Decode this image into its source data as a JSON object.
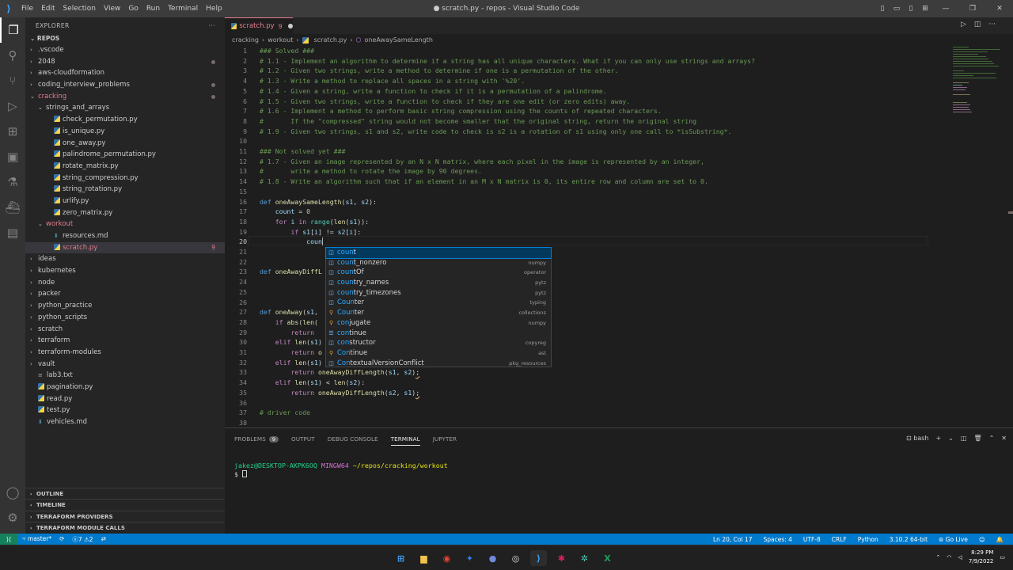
{
  "window": {
    "title": "● scratch.py - repos - Visual Studio Code"
  },
  "menu": [
    "File",
    "Edit",
    "Selection",
    "View",
    "Go",
    "Run",
    "Terminal",
    "Help"
  ],
  "explorer": {
    "header": "EXPLORER",
    "root": "REPOS",
    "rows": [
      {
        "indent": 1,
        "kind": "folder",
        "label": ".vscode",
        "mod": false,
        "open": false
      },
      {
        "indent": 1,
        "kind": "folder",
        "label": "2048",
        "mod": false,
        "open": false,
        "dot": true
      },
      {
        "indent": 1,
        "kind": "folder",
        "label": "aws-cloudformation",
        "mod": false,
        "open": false
      },
      {
        "indent": 1,
        "kind": "folder",
        "label": "coding_interview_problems",
        "mod": false,
        "open": false,
        "dot": true
      },
      {
        "indent": 1,
        "kind": "folder",
        "label": "cracking",
        "mod": true,
        "open": true,
        "dot": true
      },
      {
        "indent": 2,
        "kind": "folder",
        "label": "strings_and_arrays",
        "mod": false,
        "open": true
      },
      {
        "indent": 3,
        "kind": "py",
        "label": "check_permutation.py"
      },
      {
        "indent": 3,
        "kind": "py",
        "label": "is_unique.py"
      },
      {
        "indent": 3,
        "kind": "py",
        "label": "one_away.py"
      },
      {
        "indent": 3,
        "kind": "py",
        "label": "palindrome_permutation.py"
      },
      {
        "indent": 3,
        "kind": "py",
        "label": "rotate_matrix.py"
      },
      {
        "indent": 3,
        "kind": "py",
        "label": "string_compression.py"
      },
      {
        "indent": 3,
        "kind": "py",
        "label": "string_rotation.py"
      },
      {
        "indent": 3,
        "kind": "py",
        "label": "urlify.py"
      },
      {
        "indent": 3,
        "kind": "py",
        "label": "zero_matrix.py"
      },
      {
        "indent": 2,
        "kind": "folder",
        "label": "workout",
        "mod": true,
        "open": true
      },
      {
        "indent": 3,
        "kind": "md",
        "label": "resources.md"
      },
      {
        "indent": 3,
        "kind": "py",
        "label": "scratch.py",
        "mod": true,
        "sel": true,
        "count": "9"
      },
      {
        "indent": 1,
        "kind": "folder",
        "label": "ideas"
      },
      {
        "indent": 1,
        "kind": "folder",
        "label": "kubernetes"
      },
      {
        "indent": 1,
        "kind": "folder",
        "label": "node"
      },
      {
        "indent": 1,
        "kind": "folder",
        "label": "packer"
      },
      {
        "indent": 1,
        "kind": "folder",
        "label": "python_practice"
      },
      {
        "indent": 1,
        "kind": "folder",
        "label": "python_scripts"
      },
      {
        "indent": 1,
        "kind": "folder",
        "label": "scratch"
      },
      {
        "indent": 1,
        "kind": "folder",
        "label": "terraform"
      },
      {
        "indent": 1,
        "kind": "folder",
        "label": "terraform-modules"
      },
      {
        "indent": 1,
        "kind": "folder",
        "label": "vault"
      },
      {
        "indent": 1,
        "kind": "txt",
        "label": "lab3.txt"
      },
      {
        "indent": 1,
        "kind": "py",
        "label": "pagination.py"
      },
      {
        "indent": 1,
        "kind": "py",
        "label": "read.py"
      },
      {
        "indent": 1,
        "kind": "py",
        "label": "test.py"
      },
      {
        "indent": 1,
        "kind": "md",
        "label": "vehicles.md"
      }
    ],
    "panels": [
      "OUTLINE",
      "TIMELINE",
      "TERRAFORM PROVIDERS",
      "TERRAFORM MODULE CALLS"
    ]
  },
  "tab": {
    "name": "scratch.py",
    "problems": "9"
  },
  "breadcrumb": [
    "cracking",
    "workout",
    "scratch.py",
    "oneAwaySameLength"
  ],
  "code": {
    "line_numbers": [
      "1",
      "2",
      "3",
      "4",
      "5",
      "6",
      "7",
      "8",
      "9",
      "10",
      "11",
      "12",
      "13",
      "14",
      "15",
      "16",
      "17",
      "18",
      "19",
      "20",
      "21",
      "22",
      "23",
      "24",
      "25",
      "26",
      "27",
      "28",
      "29",
      "30",
      "31",
      "32",
      "33",
      "34",
      "35",
      "36",
      "37",
      "38"
    ],
    "lines": {
      "l1": "### Solved ###",
      "l2": "# 1.1 - Implement an algorithm to determine if a string has all unique characters. What if you can only use strings and arrays?",
      "l3": "# 1.2 - Given two strings, write a method to determine if one is a permutation of the other.",
      "l4": "# 1.3 - Write a method to replace all spaces in a string with '%20'.",
      "l5": "# 1.4 - Given a string, write a function to check if it is a permutation of a palindrome.",
      "l6": "# 1.5 - Given two strings, write a function to check if they are one edit (or zero edits) away.",
      "l7": "# 1.6 - Implement a method to perform basic string compression using the counts of repeated characters.",
      "l8": "#       If the \"compressed\" string would not become smaller that the original string, return the original string",
      "l9": "# 1.9 - Given two strings, s1 and s2, write code to check is s2 is a rotation of s1 using only one call to *isSubstring*.",
      "l11": "### Not solved yet ###",
      "l12": "# 1.7 - Given an image represented by an N x N matrix, where each pixel in the image is represented by an integer,",
      "l13": "#       write a method to rotate the image by 90 degrees.",
      "l14": "# 1.8 - Write an algorithm such that if an element in an M x N matrix is 0, its entire row and column are set to 0.",
      "l37": "# driver code"
    }
  },
  "suggest": [
    {
      "typed": "coun",
      "rest": "t",
      "src": "",
      "icon": "var"
    },
    {
      "typed": "coun",
      "rest": "t_nonzero",
      "src": "numpy",
      "icon": "var"
    },
    {
      "typed": "coun",
      "rest": "tOf",
      "src": "operator",
      "icon": "var"
    },
    {
      "typed": "coun",
      "rest": "try_names",
      "src": "pytz",
      "icon": "var"
    },
    {
      "typed": "coun",
      "rest": "try_timezones",
      "src": "pytz",
      "icon": "var"
    },
    {
      "typed": "Coun",
      "rest": "ter",
      "src": "typing",
      "icon": "var"
    },
    {
      "typed": "Coun",
      "rest": "ter",
      "src": "collections",
      "icon": "mod"
    },
    {
      "typed": "con",
      "rest": "jugate",
      "src": "numpy",
      "icon": "mod"
    },
    {
      "typed": "con",
      "rest": "tinue",
      "src": "",
      "icon": "kw"
    },
    {
      "typed": "con",
      "rest": "structor",
      "src": "copyreg",
      "icon": "var"
    },
    {
      "typed": "Con",
      "rest": "tinue",
      "src": "ast",
      "icon": "mod"
    },
    {
      "typed": "Con",
      "rest": "textualVersionConflict",
      "src": "pkg_resources",
      "icon": "var"
    }
  ],
  "panel": {
    "tabs": {
      "problems": "PROBLEMS",
      "problems_count": "9",
      "output": "OUTPUT",
      "debug": "DEBUG CONSOLE",
      "terminal": "TERMINAL",
      "jupyter": "JUPYTER"
    },
    "shell": "bash",
    "terminal": {
      "user": "jakez@DESKTOP-AKPK6OQ",
      "host": "MINGW64",
      "path": "~/repos/cracking/workout",
      "prompt": "$"
    }
  },
  "status": {
    "branch": "master*",
    "errors": "7",
    "warnings": "2",
    "position": "Ln 20, Col 17",
    "spaces": "Spaces: 4",
    "encoding": "UTF-8",
    "eol": "CRLF",
    "language": "Python",
    "interpreter": "3.10.2 64-bit",
    "golive": "Go Live"
  },
  "taskbar": {
    "time": "8:29 PM",
    "date": "7/9/2022"
  },
  "colors": {
    "accent": "#007acc",
    "modified": "#e27e8d",
    "comment": "#6a9955",
    "keyword": "#569cd6",
    "function": "#dcdcaa"
  }
}
